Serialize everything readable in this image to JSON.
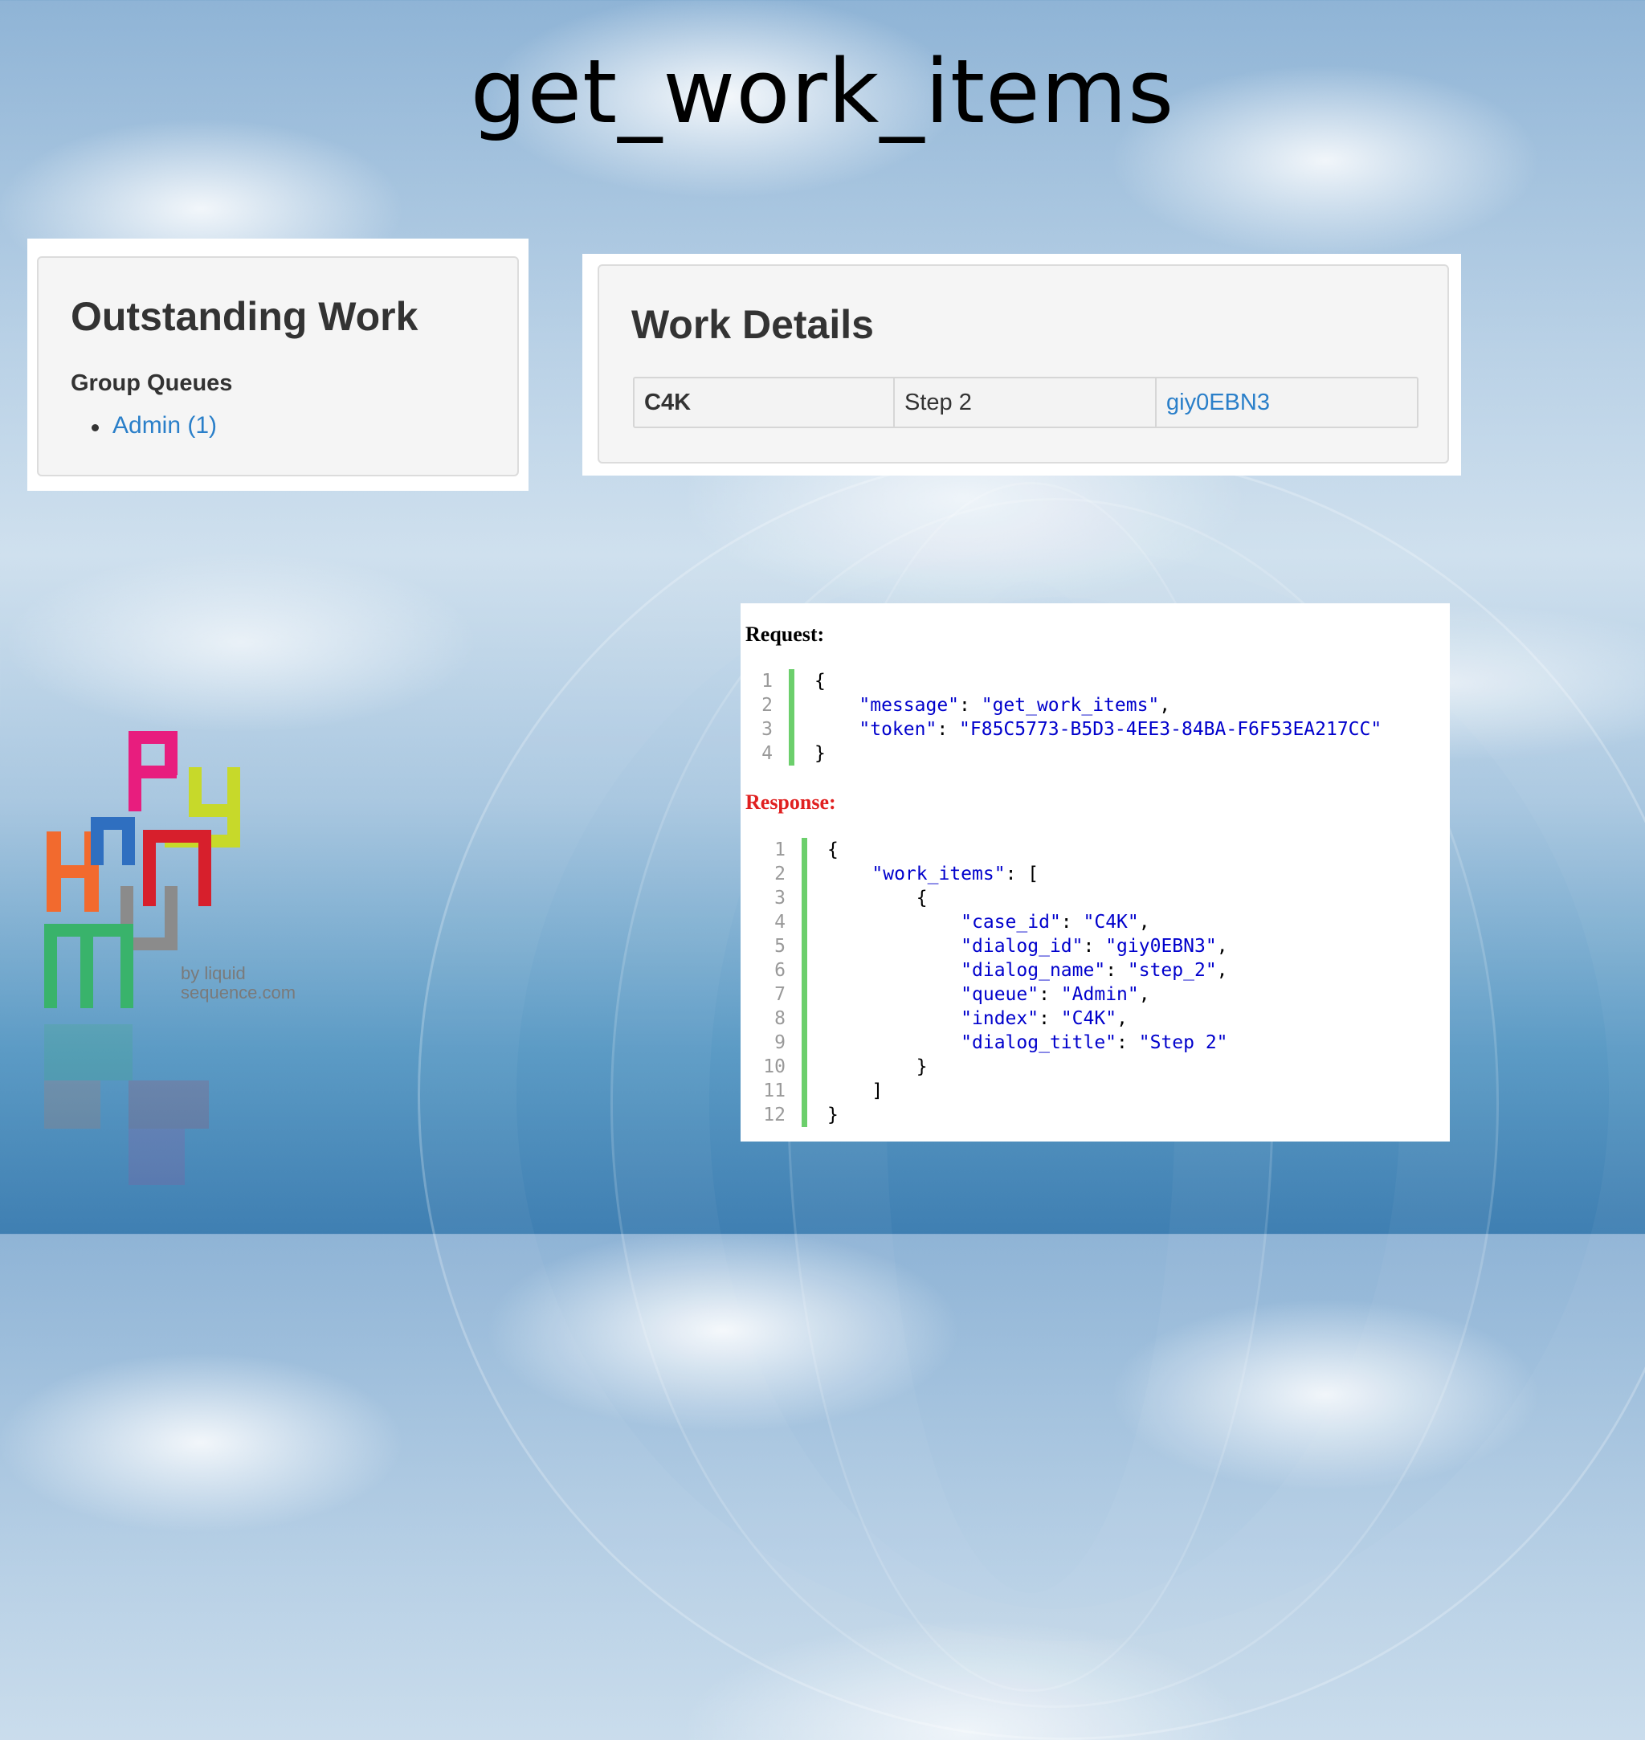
{
  "slide": {
    "title": "get_work_items"
  },
  "outstanding_work": {
    "title": "Outstanding Work",
    "group_label": "Group Queues",
    "queues": [
      {
        "label": "Admin (1)"
      }
    ]
  },
  "work_details": {
    "title": "Work Details",
    "row": {
      "case": "C4K",
      "step": "Step 2",
      "dialog_id": "giy0EBN3"
    }
  },
  "request": {
    "label": "Request:",
    "lines": [
      {
        "n": "1",
        "indent": "",
        "key": "",
        "sep": "{",
        "val": "",
        "end": ""
      },
      {
        "n": "2",
        "indent": "    ",
        "key": "\"message\"",
        "sep": ": ",
        "val": "\"get_work_items\"",
        "end": ","
      },
      {
        "n": "3",
        "indent": "    ",
        "key": "\"token\"",
        "sep": ": ",
        "val": "\"F85C5773-B5D3-4EE3-84BA-F6F53EA217CC\"",
        "end": ""
      },
      {
        "n": "4",
        "indent": "",
        "key": "",
        "sep": "}",
        "val": "",
        "end": ""
      }
    ]
  },
  "response": {
    "label": "Response:",
    "lines": [
      {
        "n": "1",
        "indent": "",
        "key": "",
        "sep": "{",
        "val": "",
        "end": ""
      },
      {
        "n": "2",
        "indent": "    ",
        "key": "\"work_items\"",
        "sep": ": [",
        "val": "",
        "end": ""
      },
      {
        "n": "3",
        "indent": "        ",
        "key": "",
        "sep": "{",
        "val": "",
        "end": ""
      },
      {
        "n": "4",
        "indent": "            ",
        "key": "\"case_id\"",
        "sep": ": ",
        "val": "\"C4K\"",
        "end": ","
      },
      {
        "n": "5",
        "indent": "            ",
        "key": "\"dialog_id\"",
        "sep": ": ",
        "val": "\"giy0EBN3\"",
        "end": ","
      },
      {
        "n": "6",
        "indent": "            ",
        "key": "\"dialog_name\"",
        "sep": ": ",
        "val": "\"step_2\"",
        "end": ","
      },
      {
        "n": "7",
        "indent": "            ",
        "key": "\"queue\"",
        "sep": ": ",
        "val": "\"Admin\"",
        "end": ","
      },
      {
        "n": "8",
        "indent": "            ",
        "key": "\"index\"",
        "sep": ": ",
        "val": "\"C4K\"",
        "end": ","
      },
      {
        "n": "9",
        "indent": "            ",
        "key": "\"dialog_title\"",
        "sep": ": ",
        "val": "\"Step 2\"",
        "end": ""
      },
      {
        "n": "10",
        "indent": "        ",
        "key": "",
        "sep": "}",
        "val": "",
        "end": ""
      },
      {
        "n": "11",
        "indent": "    ",
        "key": "",
        "sep": "]",
        "val": "",
        "end": ""
      },
      {
        "n": "12",
        "indent": "",
        "key": "",
        "sep": "}",
        "val": "",
        "end": ""
      }
    ]
  },
  "logo": {
    "caption_line1": "by liquid",
    "caption_line2": "sequence.com"
  },
  "colors": {
    "link": "#2a7fc9",
    "request_label": "#000000",
    "response_label": "#e02020",
    "gutter": "#6ccf6c",
    "code_key": "#0000cc"
  }
}
